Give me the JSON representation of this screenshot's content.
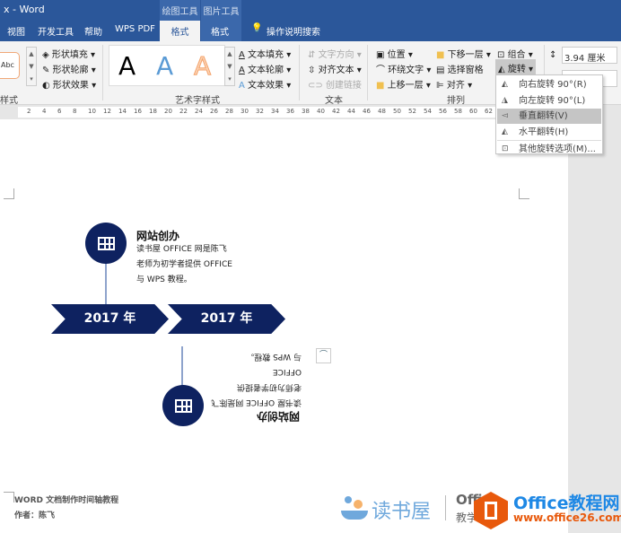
{
  "window": {
    "title": "x  -  Word"
  },
  "context_tabs": [
    "绘图工具",
    "图片工具"
  ],
  "tabs": [
    {
      "label": "视图"
    },
    {
      "label": "开发工具"
    },
    {
      "label": "帮助"
    },
    {
      "label": "WPS PDF"
    },
    {
      "label": "格式",
      "active": true
    },
    {
      "label": "格式"
    }
  ],
  "tell_me": "操作说明搜索",
  "ribbon": {
    "shape_styles": {
      "preview": "Abc",
      "fill": "形状填充",
      "outline": "形状轮廓",
      "effect": "形状效果",
      "label": "样式"
    },
    "wordart": {
      "samples": [
        "A",
        "A",
        "A"
      ],
      "text_fill": "文本填充",
      "text_outline": "文本轮廓",
      "text_effect": "文本效果",
      "label": "艺术字样式"
    },
    "text": {
      "direction": "文字方向",
      "align": "对齐文本",
      "link": "创建链接",
      "label": "文本"
    },
    "arrange": {
      "position": "位置",
      "wrap": "环绕文字",
      "forward": "上移一层",
      "backward": "下移一层",
      "pane": "选择窗格",
      "align": "对齐",
      "group": "组合",
      "rotate": "旋转",
      "label": "排列"
    },
    "size": {
      "height": "3.94 厘米"
    }
  },
  "ruler": [
    "2",
    "4",
    "6",
    "8",
    "10",
    "12",
    "14",
    "16",
    "18",
    "20",
    "22",
    "24",
    "26",
    "28",
    "30",
    "32",
    "34",
    "36",
    "38",
    "40",
    "42",
    "44",
    "46",
    "48",
    "50",
    "52",
    "54",
    "56",
    "58",
    "60",
    "62"
  ],
  "rotate_menu": [
    {
      "label": "向右旋转 90°(R)",
      "icon": "rotate-right-icon"
    },
    {
      "label": "向左旋转 90°(L)",
      "icon": "rotate-left-icon"
    },
    {
      "label": "垂直翻转(V)",
      "icon": "flip-vertical-icon",
      "highlighted": true
    },
    {
      "label": "水平翻转(H)",
      "icon": "flip-horizontal-icon"
    },
    {
      "label": "其他旋转选项(M)...",
      "icon": "more-rotate-icon"
    }
  ],
  "timeline": {
    "upper": {
      "title": "网站创办",
      "lines": [
        "读书屋  OFFICE  网是陈飞",
        "老师为初学者提供 OFFICE",
        "与 WPS 教程。"
      ]
    },
    "years": [
      "2017 年",
      "2017 年"
    ],
    "lower_flipped": {
      "title": "网站创办",
      "lines": [
        "读书屋  OFFICE  网是陈飞",
        "老师为初学者提供 OFFICE",
        "与 WPS 教程。"
      ]
    },
    "color": "#0e2260"
  },
  "footer": {
    "title": "WORD 文档制作时间轴教程",
    "author": "作者：陈飞"
  },
  "watermarks": {
    "dushuwu": "读书屋",
    "office_partial": "Offi",
    "jiaoxue_partial": "教学",
    "brand": "Office教程网",
    "url": "www.office26.com"
  }
}
